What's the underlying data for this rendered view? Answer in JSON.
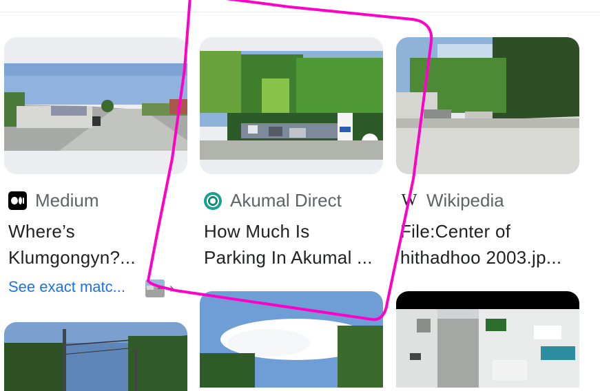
{
  "results": [
    {
      "source": "Medium",
      "source_icon": "medium-logo-icon",
      "title_lines": [
        "Where’s",
        "Klumgongyn?..."
      ]
    },
    {
      "source": "Akumal Direct",
      "source_icon": "akumal-direct-logo-icon",
      "title_lines": [
        "How Much Is",
        "Parking In Akumal ..."
      ]
    },
    {
      "source": "Wikipedia",
      "source_icon": "wikipedia-logo-icon",
      "title_lines": [
        "File:Center of",
        "hithadhoo 2003.jp..."
      ]
    }
  ],
  "see_exact_matches": "See exact matc...",
  "chevron": "›",
  "wiki_glyph": "W",
  "colors": {
    "annotation": "#ff00c8",
    "link": "#1a73e8",
    "source_text": "#5f6368",
    "title_text": "#202124"
  }
}
